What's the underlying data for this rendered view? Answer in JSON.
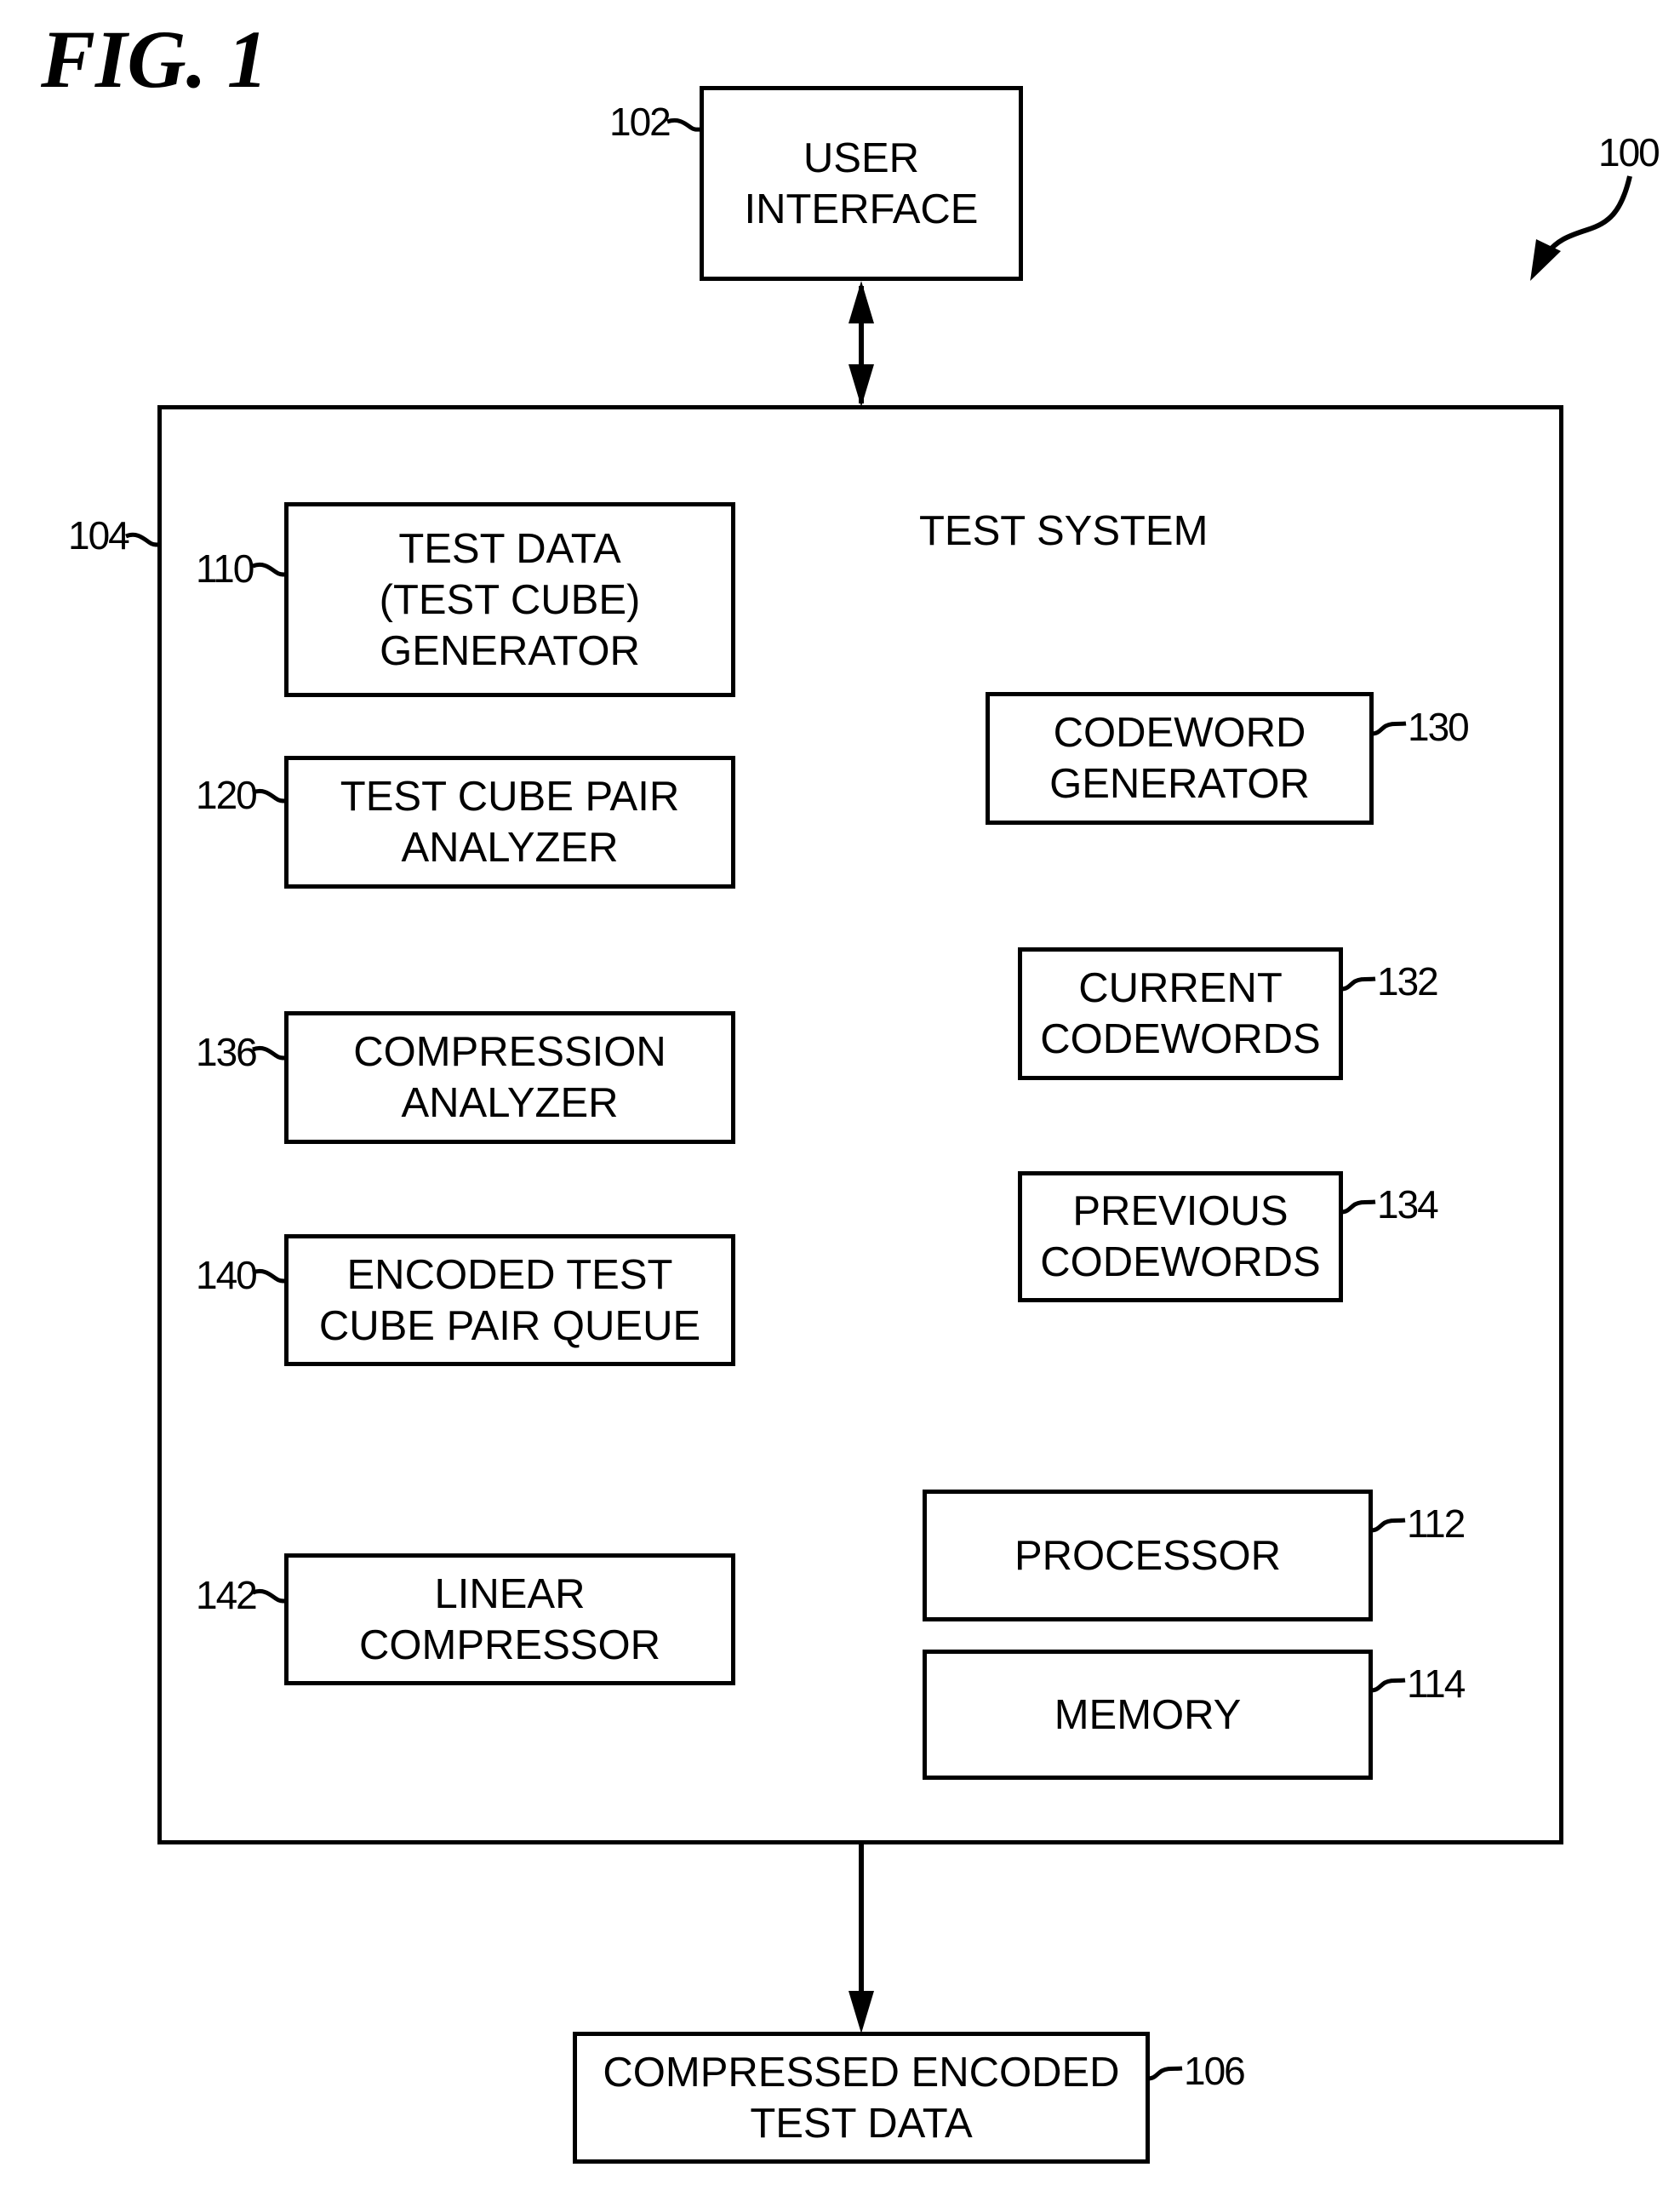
{
  "figure": {
    "title": "FIG. 1",
    "system_ref": "100"
  },
  "nodes": {
    "user_interface": {
      "ref": "102",
      "lines": [
        "USER",
        "INTERFACE"
      ]
    },
    "test_system": {
      "ref": "104",
      "title": "TEST SYSTEM"
    },
    "compressed_output": {
      "ref": "106",
      "lines": [
        "COMPRESSED ENCODED",
        "TEST DATA"
      ]
    },
    "test_data_generator": {
      "ref": "110",
      "lines": [
        "TEST DATA",
        "(TEST CUBE)",
        "GENERATOR"
      ]
    },
    "test_cube_pair_analyzer": {
      "ref": "120",
      "lines": [
        "TEST CUBE PAIR",
        "ANALYZER"
      ]
    },
    "compression_analyzer": {
      "ref": "136",
      "lines": [
        "COMPRESSION",
        "ANALYZER"
      ]
    },
    "encoded_queue": {
      "ref": "140",
      "lines": [
        "ENCODED TEST",
        "CUBE PAIR QUEUE"
      ]
    },
    "linear_compressor": {
      "ref": "142",
      "lines": [
        "LINEAR",
        "COMPRESSOR"
      ]
    },
    "codeword_generator": {
      "ref": "130",
      "lines": [
        "CODEWORD",
        "GENERATOR"
      ]
    },
    "current_codewords": {
      "ref": "132",
      "lines": [
        "CURRENT",
        "CODEWORDS"
      ]
    },
    "previous_codewords": {
      "ref": "134",
      "lines": [
        "PREVIOUS",
        "CODEWORDS"
      ]
    },
    "processor": {
      "ref": "112",
      "lines": [
        "PROCESSOR"
      ]
    },
    "memory": {
      "ref": "114",
      "lines": [
        "MEMORY"
      ]
    }
  },
  "edges": [
    {
      "from": "user_interface",
      "to": "test_system",
      "direction": "bidirectional"
    },
    {
      "from": "test_system",
      "to": "compressed_output",
      "direction": "forward"
    }
  ],
  "colors": {
    "ink": "#000000",
    "background": "#ffffff"
  }
}
